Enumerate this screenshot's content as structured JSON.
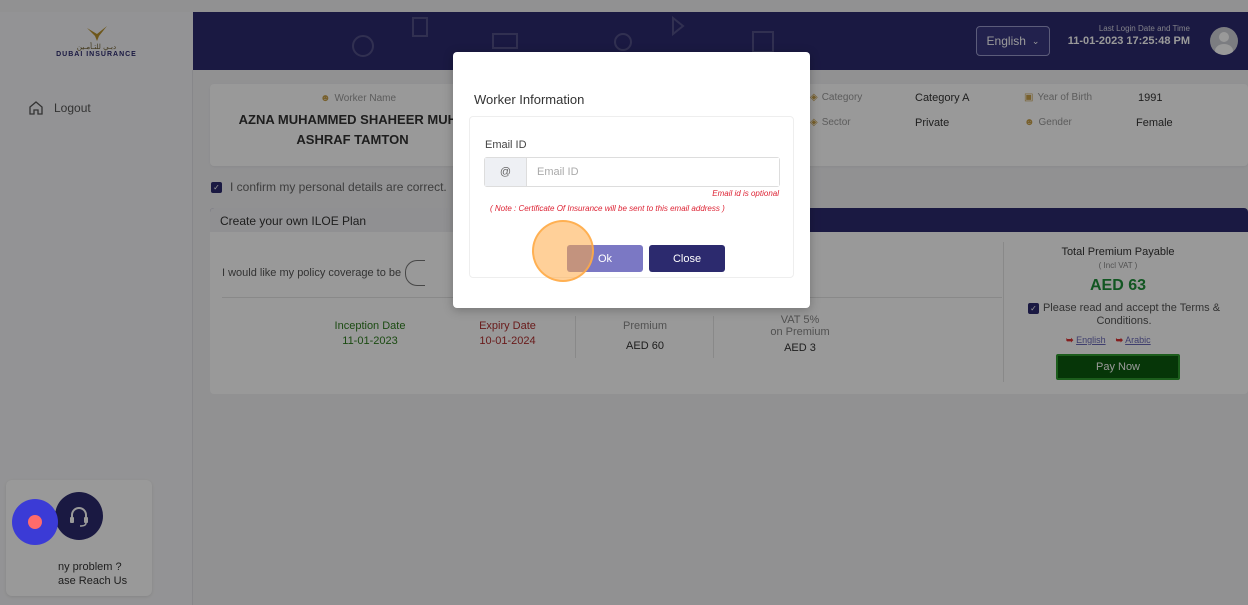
{
  "header": {
    "logo_ar": "دبـي للتـأمـين",
    "logo_en": "DUBAI INSURANCE",
    "language": "English",
    "login_label": "Last Login Date and Time",
    "login_time": "11-01-2023 17:25:48 PM"
  },
  "sidebar": {
    "logout": "Logout",
    "help_line1": "ny problem ?",
    "help_line2": "ase Reach Us"
  },
  "worker": {
    "name_label": "Worker Name",
    "name": "AZNA MUHAMMED SHAHEER MUHA ASHRAF TAMTON",
    "category_label": "Category",
    "category": "Category A",
    "sector_label": "Sector",
    "sector": "Private",
    "yob_label": "Year of Birth",
    "yob": "1991",
    "gender_label": "Gender",
    "gender": "Female"
  },
  "confirm_text": "I confirm my personal details are correct.",
  "plan": {
    "title": "Create your own ILOE Plan",
    "coverage_label": "I would like my policy coverage to be",
    "inception_label": "Inception Date",
    "inception_date": "11-01-2023",
    "expiry_label": "Expiry Date",
    "expiry_date": "10-01-2024",
    "premium_label": "Premium",
    "premium_value": "AED 60",
    "vat_label1": "VAT 5%",
    "vat_label2": "on Premium",
    "vat_value": "AED 3",
    "total_label": "Total Premium Payable",
    "total_sub": "( Incl VAT )",
    "total_value": "AED 63",
    "terms": "Please read and accept the Terms & Conditions.",
    "link_english": "English",
    "link_arabic": "Arabic",
    "pay_now": "Pay Now"
  },
  "modal": {
    "title": "Worker Information",
    "email_label": "Email ID",
    "email_addon": "@",
    "email_placeholder": "Email ID",
    "optional_note": "Email id is optional",
    "certificate_note": "( Note : Certificate Of Insurance will be sent to this email address )",
    "ok_label": "Ok",
    "close_label": "Close"
  },
  "colors": {
    "brand_navy": "#2c2a6e",
    "success_green": "#1e8f3a",
    "error_red": "#d22233"
  }
}
